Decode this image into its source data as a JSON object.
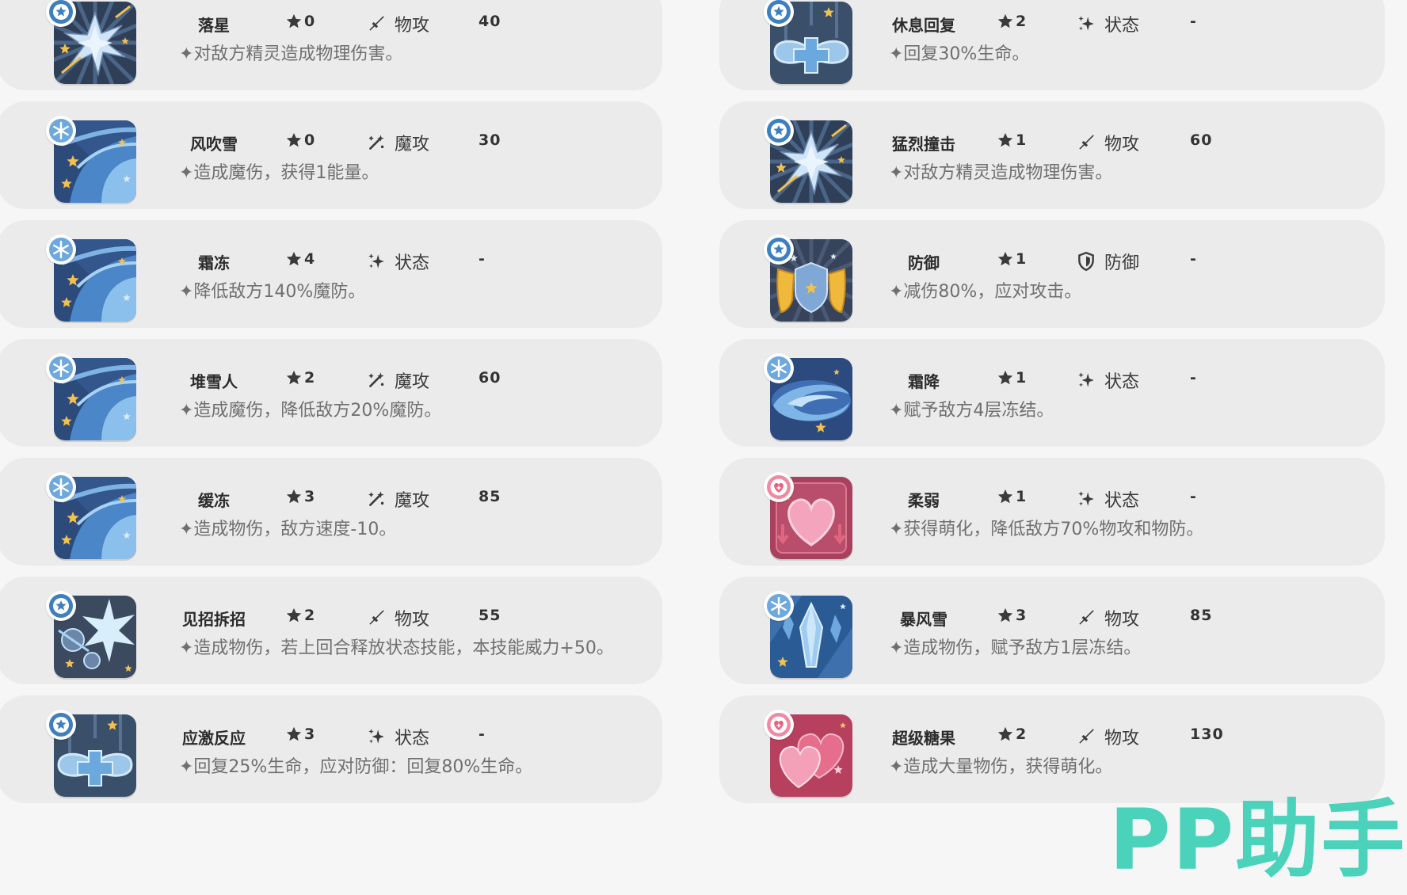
{
  "colors": {
    "card_bg": "#ebebec",
    "page_bg": "#f6f6f7",
    "watermark": "#3cd0b5",
    "badge_blue": "#3e7fc0",
    "badge_pink": "#e9607f"
  },
  "skills_left": [
    {
      "name": "落星",
      "cost": "0",
      "category": "物攻",
      "category_icon": "sword-icon",
      "power": "40",
      "desc": "✦对敌方精灵造成物理伤害。",
      "art": "shatter-icon",
      "badge": "star-badge-icon"
    },
    {
      "name": "风吹雪",
      "cost": "0",
      "category": "魔攻",
      "category_icon": "magic-icon",
      "power": "30",
      "desc": "✦造成魔伤，获得1能量。",
      "art": "blizzard-swirl-icon",
      "badge": "snowflake-badge-icon"
    },
    {
      "name": "霜冻",
      "cost": "4",
      "category": "状态",
      "category_icon": "sparkle-icon",
      "power": "-",
      "desc": "✦降低敌方140%魔防。",
      "art": "blizzard-swirl-icon",
      "badge": "snowflake-badge-icon"
    },
    {
      "name": "堆雪人",
      "cost": "2",
      "category": "魔攻",
      "category_icon": "magic-icon",
      "power": "60",
      "desc": "✦造成魔伤，降低敌方20%魔防。",
      "art": "blizzard-swirl-icon",
      "badge": "snowflake-badge-icon"
    },
    {
      "name": "缓冻",
      "cost": "3",
      "category": "魔攻",
      "category_icon": "magic-icon",
      "power": "85",
      "desc": "✦造成物伤，敌方速度-10。",
      "art": "blizzard-swirl-icon",
      "badge": "snowflake-badge-icon"
    },
    {
      "name": "见招拆招",
      "cost": "2",
      "category": "物攻",
      "category_icon": "sword-icon",
      "power": "55",
      "desc": "✦造成物伤，若上回合释放状态技能，本技能威力+50。",
      "art": "counter-burst-icon",
      "badge": "star-badge-icon"
    },
    {
      "name": "应激反应",
      "cost": "3",
      "category": "状态",
      "category_icon": "sparkle-icon",
      "power": "-",
      "desc": "✦回复25%生命，应对防御：回复80%生命。",
      "art": "heal-cross-icon",
      "badge": "star-badge-icon"
    }
  ],
  "skills_right": [
    {
      "name": "休息回复",
      "cost": "2",
      "category": "状态",
      "category_icon": "sparkle-icon",
      "power": "-",
      "desc": "✦回复30%生命。",
      "art": "heal-cross-icon",
      "badge": "star-badge-icon"
    },
    {
      "name": "猛烈撞击",
      "cost": "1",
      "category": "物攻",
      "category_icon": "sword-icon",
      "power": "60",
      "desc": "✦对敌方精灵造成物理伤害。",
      "art": "shatter-icon",
      "badge": "star-badge-icon"
    },
    {
      "name": "防御",
      "cost": "1",
      "category": "防御",
      "category_icon": "shield-icon",
      "power": "-",
      "desc": "✦减伤80%，应对攻击。",
      "art": "shield-art-icon",
      "badge": "star-badge-icon"
    },
    {
      "name": "霜降",
      "cost": "1",
      "category": "状态",
      "category_icon": "sparkle-icon",
      "power": "-",
      "desc": "✦赋予敌方4层冻结。",
      "art": "frost-vortex-icon",
      "badge": "snowflake-badge-icon"
    },
    {
      "name": "柔弱",
      "cost": "1",
      "category": "状态",
      "category_icon": "sparkle-icon",
      "power": "-",
      "desc": "✦获得萌化，降低敌方70%物攻和物防。",
      "art": "heart-down-icon",
      "badge": "heart-badge-icon"
    },
    {
      "name": "暴风雪",
      "cost": "3",
      "category": "物攻",
      "category_icon": "sword-icon",
      "power": "85",
      "desc": "✦造成物伤，赋予敌方1层冻结。",
      "art": "ice-shard-icon",
      "badge": "snowflake-badge-icon"
    },
    {
      "name": "超级糖果",
      "cost": "2",
      "category": "物攻",
      "category_icon": "sword-icon",
      "power": "130",
      "desc": "✦造成大量物伤，获得萌化。",
      "art": "double-heart-icon",
      "badge": "heart-badge-icon"
    }
  ],
  "watermark": "PP助手"
}
